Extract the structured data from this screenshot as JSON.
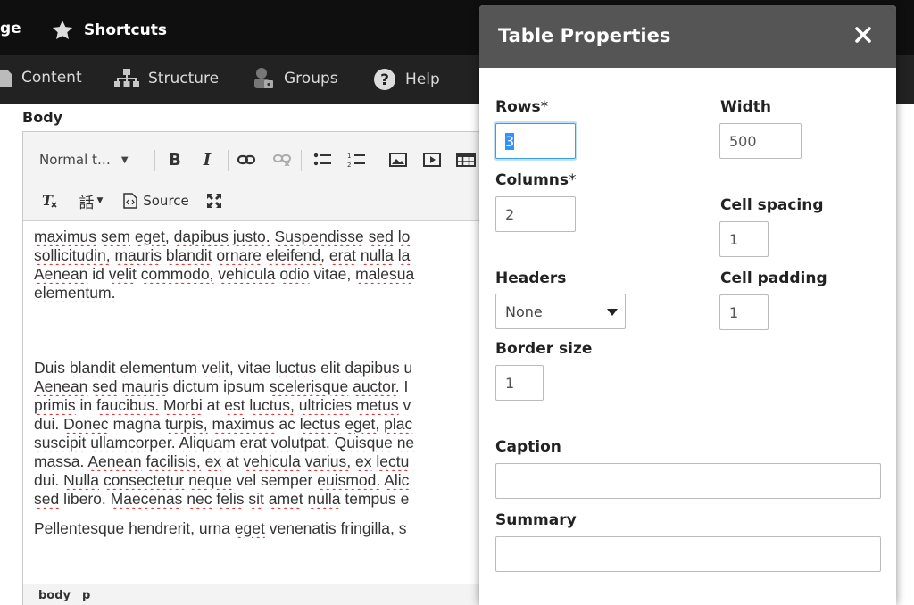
{
  "admin": {
    "toolbar_items": [
      "ge",
      "Shortcuts"
    ],
    "nav_items": [
      "Content",
      "Structure",
      "Groups",
      "Help"
    ]
  },
  "editor": {
    "field_label": "Body",
    "format_select": "Normal t…",
    "source_label": "Source",
    "paragraphs": [
      [
        "maximus sem eget, dapibus justo. Suspendisse sed lo",
        "sollicitudin, mauris blandit ornare eleifend, erat nulla la",
        "Aenean id velit commodo, vehicula odio vitae, malesua",
        "elementum."
      ],
      [
        "Duis blandit elementum velit, vitae luctus elit dapibus u",
        "Aenean sed mauris dictum ipsum scelerisque auctor. I",
        "primis in faucibus. Morbi at est luctus, ultricies metus v",
        "dui. Donec magna turpis, maximus ac lectus eget, plac",
        "suscipit ullamcorper. Aliquam erat volutpat. Quisque ne",
        "massa. Aenean facilisis, ex at vehicula varius, ex lectu",
        "dui. Nulla consectetur neque vel semper euismod. Alic",
        "sed libero. Maecenas nec felis sit amet nulla tempus e"
      ],
      [
        "Pellentesque hendrerit, urna eget venenatis fringilla, s"
      ]
    ],
    "status_path": [
      "body",
      "p"
    ]
  },
  "dialog": {
    "title": "Table Properties",
    "rows_label": "Rows",
    "rows_value": "3",
    "columns_label": "Columns",
    "columns_value": "2",
    "required_mark": "*",
    "width_label": "Width",
    "width_value": "500",
    "cell_spacing_label": "Cell spacing",
    "cell_spacing_value": "1",
    "cell_padding_label": "Cell padding",
    "cell_padding_value": "1",
    "headers_label": "Headers",
    "headers_value": "None",
    "border_label": "Border size",
    "border_value": "1",
    "caption_label": "Caption",
    "caption_value": "",
    "summary_label": "Summary",
    "summary_value": ""
  },
  "colors": {
    "dialog_header": "#555555",
    "focus_ring": "#3a9ee5",
    "spellcheck": "#dd2222"
  }
}
